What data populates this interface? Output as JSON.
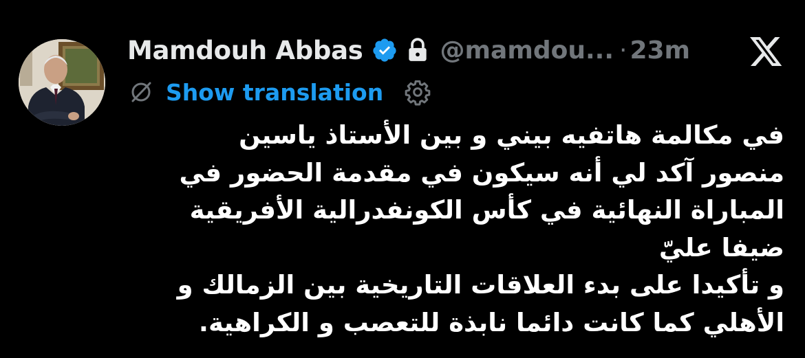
{
  "tweet": {
    "author": {
      "display_name": "Mamdouh Abbas",
      "handle": "@mamdou...",
      "verified_icon": "verified-badge-icon",
      "lock_icon": "lock-icon",
      "avatar": "avatar"
    },
    "separator": "·",
    "time": "23m",
    "platform_icon": "x-logo-icon",
    "translation": {
      "icon": "translate-icon",
      "label": "Show translation",
      "settings_icon": "gear-icon"
    },
    "text_lines": [
      "في مكالمة هاتفيه بيني و بين الأستاذ ياسين",
      "منصور آكد لي أنه سيكون في مقدمة الحضور في",
      "المباراة النهائية في كأس الكونفدرالية الأفريقية",
      "ضيفا عليّ",
      "و تأكيدا على بدء العلاقات التاريخية بين الزمالك و",
      "الأهلي كما كانت دائما نابذة للتعصب و الكراهية."
    ]
  },
  "colors": {
    "background": "#000000",
    "primary_text": "#e7e9ea",
    "secondary_text": "#71767b",
    "accent": "#1d9bf0"
  }
}
